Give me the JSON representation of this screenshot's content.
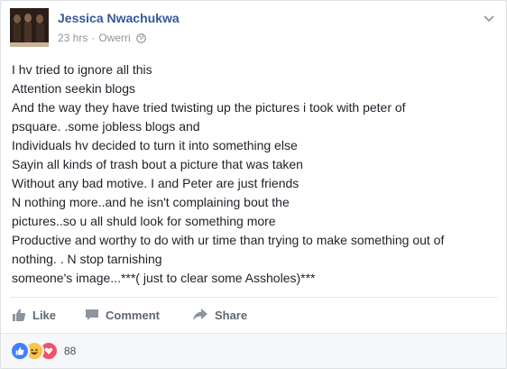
{
  "post": {
    "author": "Jessica Nwachukwa",
    "time": "23 hrs",
    "location": "Owerri",
    "separator": "·",
    "privacy_icon": "globe-icon",
    "menu_icon": "chevron-down-icon",
    "body_lines": [
      "I hv tried to ignore all this",
      "Attention seekin blogs",
      "And the way they have tried twisting up the pictures i took with peter of",
      "psquare. .some jobless blogs and",
      "Individuals hv decided to turn it into something else",
      "Sayin all kinds of trash bout a picture that was taken",
      "Without any bad motive. I and Peter are just friends",
      "N nothing more..and he isn't complaining bout the",
      "pictures..so u all shuld look for something more",
      "Productive and worthy to do with ur time than trying to make something out of",
      "nothing. . N stop tarnishing",
      "someone's image...***( just to clear some Assholes)***"
    ]
  },
  "actions": {
    "like_label": "Like",
    "comment_label": "Comment",
    "share_label": "Share"
  },
  "reactions": {
    "icons": [
      "like-reaction-icon",
      "haha-reaction-icon",
      "love-reaction-icon"
    ],
    "count": "88"
  },
  "colors": {
    "author_link": "#365899",
    "text": "#1d2129",
    "muted": "#90949c",
    "action": "#606770",
    "like_reaction": "#4080ff",
    "haha_reaction": "#f7c54c",
    "love_reaction": "#f25268"
  }
}
